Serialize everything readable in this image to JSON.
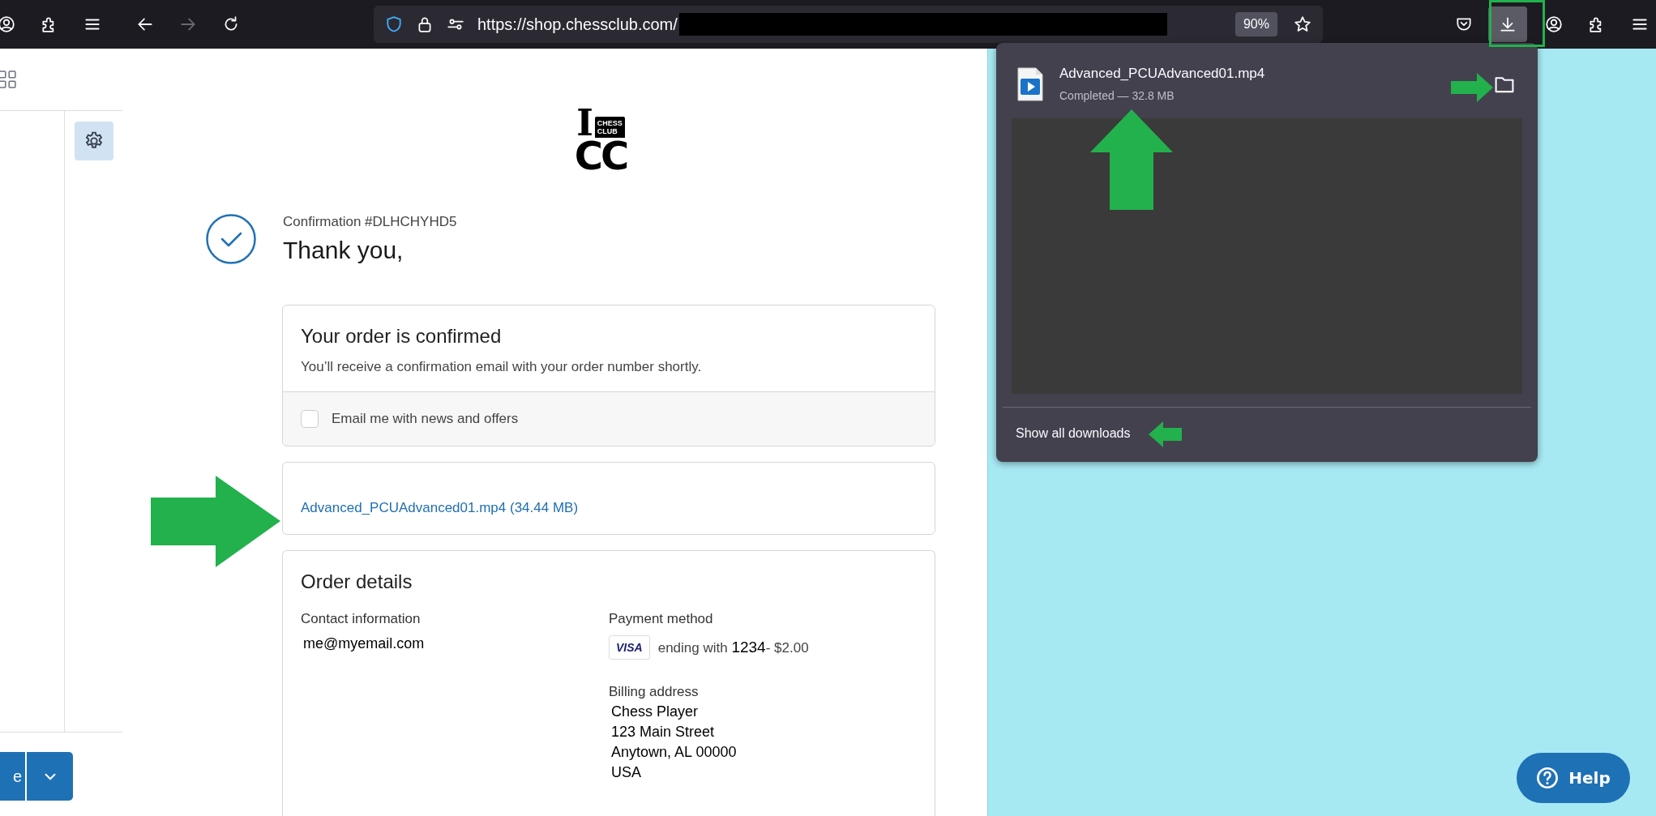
{
  "browser": {
    "nav": [
      {
        "kind": "back",
        "disabled": false
      },
      {
        "kind": "forward",
        "disabled": true
      }
    ],
    "url": "https://shop.chessclub.com/",
    "zoom": "90%",
    "downloads_open": true
  },
  "sidebar": {
    "button_label": "e"
  },
  "page": {
    "logo": {
      "top": "I",
      "badge_lines": [
        "CHESS",
        "CLUB"
      ],
      "bottom": "CC"
    },
    "confirmation": "Confirmation #DLHCHYHD5",
    "thank_you": "Thank you,",
    "order_card": {
      "title": "Your order is confirmed",
      "message": "You’ll receive a confirmation email with your order number shortly.",
      "newsletter": {
        "label": "Email me with news and offers",
        "checked": false
      }
    },
    "download_link": "Advanced_PCUAdvanced01.mp4 (34.44 MB)",
    "order_details": {
      "title": "Order details",
      "contact": {
        "label": "Contact information",
        "email": "me@myemail.com"
      },
      "payment": {
        "label": "Payment method",
        "card_logo": "VISA",
        "text": "ending with **1234**- $2.00"
      },
      "billing": {
        "label": "Billing address",
        "lines": [
          "Chess Player",
          "123 Main Street",
          "Anytown, AL 00000",
          "USA"
        ]
      }
    }
  },
  "downloads_panel": {
    "items": [
      {
        "name": "Advanced_PCUAdvanced01.mp4",
        "status": "Completed — 32.8 MB"
      }
    ],
    "show_all": "Show all downloads"
  },
  "help": {
    "label": "Help"
  }
}
